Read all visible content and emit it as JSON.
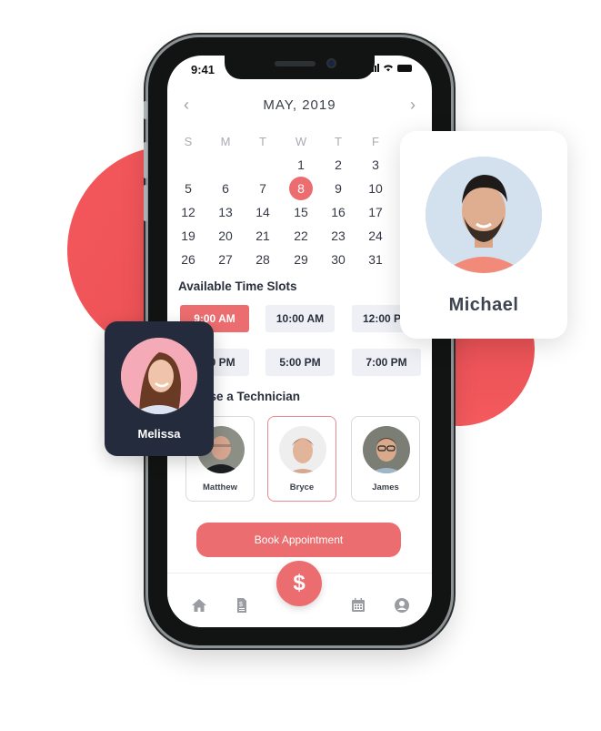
{
  "status_bar": {
    "time": "9:41"
  },
  "calendar": {
    "title": "MAY, 2019",
    "weekdays": [
      "S",
      "M",
      "T",
      "W",
      "T",
      "F"
    ],
    "weeks": [
      [
        "",
        "",
        "",
        "1",
        "2",
        "3"
      ],
      [
        "5",
        "6",
        "7",
        "8",
        "9",
        "10"
      ],
      [
        "12",
        "13",
        "14",
        "15",
        "16",
        "17"
      ],
      [
        "19",
        "20",
        "21",
        "22",
        "23",
        "24"
      ],
      [
        "26",
        "27",
        "28",
        "29",
        "30",
        "31"
      ]
    ],
    "selected_day": "8",
    "prev_icon": "chevron-left-icon",
    "next_icon": "chevron-right-icon"
  },
  "time_slots": {
    "title": "Available Time Slots",
    "slots": [
      "9:00 AM",
      "10:00 AM",
      "12:00 PM",
      "3:00 PM",
      "5:00 PM",
      "7:00 PM"
    ],
    "selected": "9:00 AM"
  },
  "technicians": {
    "title": "Choose a Technician",
    "items": [
      {
        "name": "Matthew"
      },
      {
        "name": "Bryce",
        "selected": true
      },
      {
        "name": "James"
      }
    ]
  },
  "book_button": {
    "label": "Book Appointment"
  },
  "tabbar": {
    "items": [
      "home-icon",
      "invoice-icon",
      "dollar-icon",
      "calendar-icon",
      "profile-icon"
    ],
    "fab_label": "$"
  },
  "cards": {
    "michael": {
      "name": "Michael"
    },
    "melissa": {
      "name": "Melissa"
    }
  },
  "colors": {
    "accent": "#ec6d6f",
    "dark_card": "#232b3d",
    "background_circle": "#f4585c"
  }
}
